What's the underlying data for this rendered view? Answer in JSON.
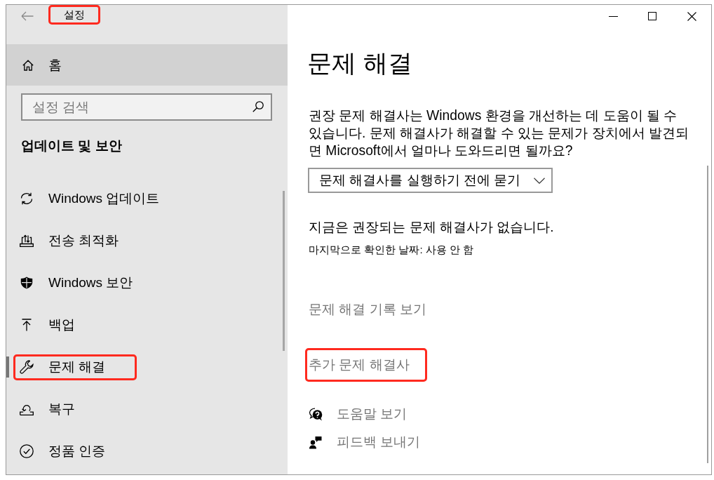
{
  "window": {
    "title": "설정",
    "title_highlighted": true
  },
  "sidebar": {
    "home": {
      "label": "홈",
      "hovered": true
    },
    "search": {
      "placeholder": "설정 검색"
    },
    "section_title": "업데이트 및 보안",
    "items": [
      {
        "kind": "update",
        "label": "Windows 업데이트",
        "selected": false,
        "highlighted": false
      },
      {
        "kind": "delivery",
        "label": "전송 최적화",
        "selected": false,
        "highlighted": false
      },
      {
        "kind": "security",
        "label": "Windows 보안",
        "selected": false,
        "highlighted": false
      },
      {
        "kind": "backup",
        "label": "백업",
        "selected": false,
        "highlighted": false
      },
      {
        "kind": "troubleshoot",
        "label": "문제 해결",
        "selected": true,
        "highlighted": true
      },
      {
        "kind": "recovery",
        "label": "복구",
        "selected": false,
        "highlighted": false
      },
      {
        "kind": "activation",
        "label": "정품 인증",
        "selected": false,
        "highlighted": false
      }
    ]
  },
  "content": {
    "title": "문제 해결",
    "description": "권장 문제 해결사는 Windows 환경을 개선하는 데 도움이 될 수 있습니다. 문제 해결사가 해결할 수 있는 문제가 장치에서 발견되면 Microsoft에서 얼마나 도와드리면 될까요?",
    "dropdown": {
      "value": "문제 해결사를 실행하기 전에 묻기"
    },
    "status": "지금은 권장되는 문제 해결사가 없습니다.",
    "last_checked": "마지막으로 확인한 날짜: 사용 안 함",
    "links": [
      {
        "label": "문제 해결 기록 보기",
        "highlighted": false
      },
      {
        "label": "추가 문제 해결사",
        "highlighted": true
      }
    ],
    "help_links": [
      {
        "kind": "help",
        "label": "도움말 보기"
      },
      {
        "kind": "feedback",
        "label": "피드백 보내기"
      }
    ]
  }
}
